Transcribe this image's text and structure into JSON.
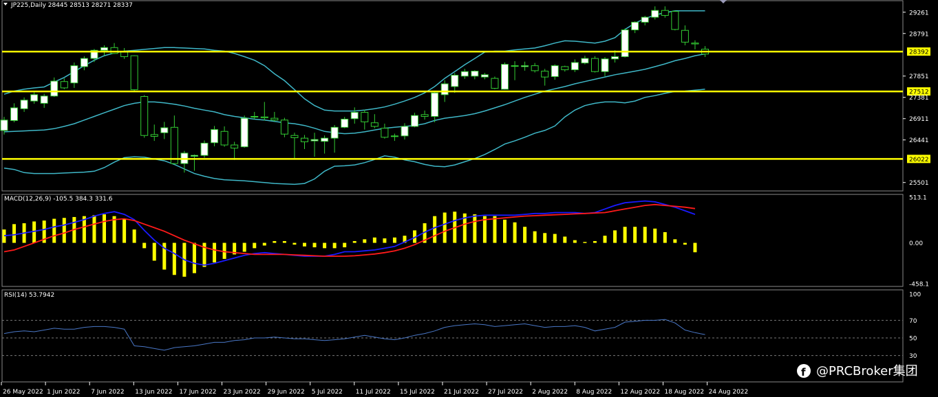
{
  "header": {
    "symbol_label": "JP225,Daily  28445 28513 28271 28337",
    "macd_label": "MACD(12,26,9) -105.5 384.3 331.6",
    "rsi_label": "RSI(14) 53.7942"
  },
  "watermark": {
    "text": "@PRCBroker集团"
  },
  "colors": {
    "background": "#000000",
    "up_candle_fill": "#ffffff",
    "candle_outline": "#33cc33",
    "bollinger": "#3fb8c8",
    "level_line": "#ffff00",
    "macd_hist": "#ffff00",
    "macd_line": "#1a1aff",
    "signal_line": "#ff1a1a",
    "rsi_line": "#4a78c8",
    "grid": "#7a7a7a"
  },
  "chart_data": [
    {
      "type": "candlestick",
      "title": "JP225,Daily",
      "price_axis_ticks": [
        "29261",
        "28791",
        "28392",
        "27851",
        "27512",
        "27381",
        "26911",
        "26441",
        "26022",
        "25501"
      ],
      "ylim": [
        25330,
        29500
      ],
      "level_lines": [
        {
          "value": 28392,
          "label": "28392"
        },
        {
          "value": 27512,
          "label": "27512"
        },
        {
          "value": 26022,
          "label": "26022"
        }
      ],
      "date_labels": [
        "26 May 2022",
        "1 Jun 2022",
        "7 Jun 2022",
        "13 Jun 2022",
        "17 Jun 2022",
        "23 Jun 2022",
        "29 Jun 2022",
        "5 Jul 2022",
        "11 Jul 2022",
        "15 Jul 2022",
        "21 Jul 2022",
        "27 Jul 2022",
        "2 Aug 2022",
        "8 Aug 2022",
        "12 Aug 2022",
        "18 Aug 2022",
        "24 Aug 2022"
      ],
      "ohlc": [
        [
          26650,
          26950,
          26560,
          26880
        ],
        [
          26870,
          27250,
          26830,
          27150
        ],
        [
          27130,
          27380,
          27060,
          27320
        ],
        [
          27300,
          27490,
          27240,
          27440
        ],
        [
          27250,
          27460,
          27150,
          27410
        ],
        [
          27410,
          27820,
          27390,
          27740
        ],
        [
          27730,
          27800,
          27560,
          27590
        ],
        [
          27700,
          28150,
          27590,
          28080
        ],
        [
          28060,
          28290,
          27980,
          28240
        ],
        [
          28240,
          28450,
          28160,
          28420
        ],
        [
          28420,
          28530,
          28300,
          28480
        ],
        [
          28480,
          28580,
          28340,
          28350
        ],
        [
          28380,
          28470,
          28230,
          28280
        ],
        [
          28300,
          28310,
          27510,
          27550
        ],
        [
          27400,
          27430,
          26490,
          26540
        ],
        [
          26560,
          26780,
          26420,
          26520
        ],
        [
          26600,
          26840,
          26460,
          26710
        ],
        [
          26720,
          26980,
          25900,
          25920
        ],
        [
          25920,
          26200,
          25720,
          26150
        ],
        [
          26080,
          26120,
          25760,
          26100
        ],
        [
          26100,
          26430,
          26050,
          26370
        ],
        [
          26380,
          26750,
          26300,
          26670
        ],
        [
          26630,
          26740,
          26290,
          26330
        ],
        [
          26330,
          26400,
          26000,
          26260
        ],
        [
          26290,
          26980,
          26270,
          26920
        ],
        [
          26960,
          27060,
          26900,
          26950
        ],
        [
          26950,
          27280,
          26870,
          26930
        ],
        [
          26920,
          27060,
          26850,
          26880
        ],
        [
          26880,
          26930,
          26500,
          26570
        ],
        [
          26540,
          26600,
          26040,
          26490
        ],
        [
          26480,
          26550,
          26240,
          26400
        ],
        [
          26420,
          26600,
          26070,
          26450
        ],
        [
          26410,
          26540,
          26140,
          26480
        ],
        [
          26480,
          26770,
          26160,
          26720
        ],
        [
          26720,
          26950,
          26700,
          26900
        ],
        [
          26910,
          27160,
          26800,
          27050
        ],
        [
          27050,
          27110,
          26670,
          26840
        ],
        [
          26820,
          27010,
          26700,
          26740
        ],
        [
          26700,
          26800,
          26470,
          26500
        ],
        [
          26520,
          26580,
          26420,
          26530
        ],
        [
          26530,
          26810,
          26450,
          26740
        ],
        [
          26740,
          27040,
          26720,
          26980
        ],
        [
          27000,
          27090,
          26890,
          26960
        ],
        [
          26960,
          27530,
          26830,
          27480
        ],
        [
          27440,
          27760,
          27280,
          27680
        ],
        [
          27620,
          27920,
          27480,
          27870
        ],
        [
          27850,
          28010,
          27790,
          27950
        ],
        [
          27850,
          27980,
          27780,
          27960
        ],
        [
          27830,
          27920,
          27780,
          27880
        ],
        [
          27800,
          27840,
          27560,
          27580
        ],
        [
          27560,
          28150,
          27550,
          28110
        ],
        [
          28080,
          28180,
          27760,
          28070
        ],
        [
          28060,
          28170,
          27970,
          28080
        ],
        [
          28080,
          28140,
          27930,
          27970
        ],
        [
          27960,
          28010,
          27640,
          27830
        ],
        [
          27840,
          28110,
          27770,
          28080
        ],
        [
          28060,
          28080,
          27950,
          27990
        ],
        [
          27990,
          28220,
          27940,
          28150
        ],
        [
          28140,
          28300,
          28110,
          28240
        ],
        [
          28240,
          28290,
          27930,
          27950
        ],
        [
          27950,
          28270,
          27850,
          28230
        ],
        [
          28230,
          28420,
          28150,
          28280
        ],
        [
          28280,
          28900,
          28260,
          28870
        ],
        [
          28870,
          29060,
          28800,
          29040
        ],
        [
          29040,
          29180,
          28970,
          29150
        ],
        [
          29150,
          29390,
          29100,
          29300
        ],
        [
          29300,
          29390,
          29140,
          29190
        ],
        [
          29280,
          29300,
          28860,
          28880
        ],
        [
          28860,
          28970,
          28530,
          28600
        ],
        [
          28580,
          28640,
          28440,
          28560
        ],
        [
          28445,
          28513,
          28271,
          28337
        ]
      ],
      "bollinger_upper": [
        27450,
        27520,
        27560,
        27590,
        27610,
        27720,
        27820,
        27950,
        28080,
        28200,
        28300,
        28360,
        28400,
        28420,
        28440,
        28460,
        28480,
        28480,
        28470,
        28460,
        28450,
        28420,
        28400,
        28350,
        28280,
        28200,
        28080,
        27900,
        27750,
        27550,
        27350,
        27200,
        27100,
        27080,
        27080,
        27080,
        27100,
        27130,
        27170,
        27230,
        27300,
        27380,
        27480,
        27620,
        27800,
        27950,
        28100,
        28240,
        28380,
        28400,
        28400,
        28430,
        28450,
        28470,
        28520,
        28580,
        28630,
        28620,
        28600,
        28580,
        28620,
        28700,
        28880,
        29020,
        29120,
        29200,
        29250,
        29290,
        29290,
        29290,
        29290
      ],
      "bollinger_middle": [
        26620,
        26630,
        26640,
        26650,
        26660,
        26690,
        26740,
        26800,
        26880,
        26960,
        27040,
        27120,
        27200,
        27250,
        27280,
        27280,
        27260,
        27230,
        27190,
        27140,
        27100,
        27060,
        27000,
        26960,
        26930,
        26900,
        26880,
        26850,
        26820,
        26800,
        26760,
        26700,
        26630,
        26600,
        26580,
        26590,
        26620,
        26660,
        26700,
        26720,
        26740,
        26760,
        26800,
        26870,
        26920,
        26950,
        26980,
        27020,
        27080,
        27150,
        27220,
        27300,
        27380,
        27450,
        27520,
        27570,
        27620,
        27680,
        27730,
        27780,
        27830,
        27880,
        27920,
        27960,
        28000,
        28060,
        28120,
        28190,
        28240,
        28300,
        28340
      ],
      "bollinger_lower": [
        25820,
        25790,
        25720,
        25700,
        25700,
        25700,
        25710,
        25720,
        25730,
        25750,
        25830,
        25950,
        26050,
        26070,
        26060,
        26020,
        25980,
        25900,
        25800,
        25700,
        25640,
        25590,
        25560,
        25550,
        25540,
        25520,
        25500,
        25480,
        25470,
        25460,
        25480,
        25580,
        25750,
        25860,
        25870,
        25890,
        25940,
        26010,
        26090,
        26060,
        26000,
        25960,
        25900,
        25860,
        25850,
        25890,
        25960,
        26030,
        26120,
        26230,
        26350,
        26420,
        26500,
        26590,
        26650,
        26750,
        26950,
        27100,
        27200,
        27250,
        27280,
        27280,
        27260,
        27300,
        27380,
        27420,
        27470,
        27510,
        27520,
        27540,
        27560
      ]
    },
    {
      "type": "bar",
      "title": "MACD(12,26,9)",
      "axis_ticks": [
        "513.1",
        "0.00",
        "-458.1"
      ],
      "ylim": [
        -458.1,
        513.1
      ],
      "histogram": [
        150,
        210,
        220,
        240,
        250,
        270,
        280,
        290,
        300,
        310,
        320,
        300,
        270,
        150,
        -60,
        -200,
        -300,
        -360,
        -380,
        -340,
        -270,
        -220,
        -180,
        -130,
        -100,
        -60,
        -30,
        20,
        20,
        -20,
        -40,
        -50,
        -60,
        -60,
        -50,
        20,
        40,
        60,
        50,
        60,
        80,
        140,
        220,
        300,
        340,
        350,
        330,
        320,
        300,
        300,
        260,
        230,
        180,
        130,
        110,
        100,
        70,
        30,
        10,
        20,
        80,
        140,
        180,
        180,
        180,
        160,
        120,
        40,
        -20,
        -105.5
      ],
      "macd": [
        80,
        90,
        110,
        130,
        150,
        180,
        200,
        230,
        260,
        300,
        330,
        350,
        320,
        260,
        140,
        30,
        -60,
        -120,
        -190,
        -230,
        -250,
        -230,
        -200,
        -170,
        -140,
        -120,
        -110,
        -120,
        -130,
        -140,
        -150,
        -150,
        -150,
        -130,
        -100,
        -100,
        -90,
        -80,
        -60,
        -40,
        10,
        60,
        120,
        170,
        210,
        250,
        280,
        300,
        310,
        310,
        310,
        310,
        320,
        330,
        330,
        340,
        340,
        340,
        330,
        340,
        380,
        420,
        450,
        460,
        470,
        460,
        430,
        400,
        360,
        320
      ],
      "signal": [
        -100,
        -80,
        -40,
        0,
        40,
        80,
        110,
        150,
        180,
        210,
        240,
        260,
        270,
        250,
        210,
        170,
        130,
        80,
        30,
        -10,
        -50,
        -80,
        -100,
        -110,
        -120,
        -130,
        -130,
        -130,
        -130,
        -135,
        -140,
        -145,
        -150,
        -150,
        -150,
        -145,
        -135,
        -125,
        -110,
        -90,
        -60,
        -20,
        30,
        80,
        130,
        170,
        210,
        240,
        260,
        270,
        280,
        290,
        300,
        305,
        310,
        315,
        320,
        325,
        330,
        335,
        340,
        360,
        380,
        400,
        420,
        430,
        420,
        410,
        400,
        384.3
      ]
    },
    {
      "type": "line",
      "title": "RSI(14)",
      "axis_ticks": [
        "100",
        "70",
        "50",
        "30",
        "0"
      ],
      "ylim": [
        0,
        100
      ],
      "reference_levels": [
        70,
        50,
        30
      ],
      "rsi": [
        55,
        57,
        58,
        57,
        59,
        61,
        60,
        60,
        62,
        63,
        63,
        62,
        60,
        41,
        40,
        38,
        36,
        39,
        40,
        41,
        43,
        45,
        45,
        47,
        48,
        50,
        50,
        51,
        50,
        49,
        49,
        48,
        47,
        48,
        49,
        51,
        53,
        51,
        49,
        48,
        50,
        53,
        55,
        58,
        62,
        64,
        65,
        66,
        65,
        63,
        64,
        65,
        66,
        64,
        62,
        63,
        63,
        64,
        62,
        58,
        60,
        62,
        68,
        69,
        70,
        70,
        71,
        67,
        59,
        56,
        53.79
      ]
    }
  ]
}
